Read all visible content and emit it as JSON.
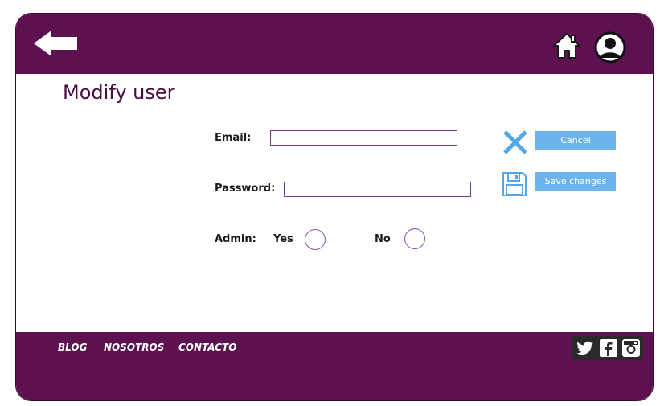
{
  "header": {
    "back": "back-arrow-icon",
    "home": "home-icon",
    "user": "user-icon"
  },
  "page": {
    "title": "Modify user"
  },
  "form": {
    "email_label": "Email:",
    "email_value": "",
    "password_label": "Password:",
    "password_value": "",
    "admin_label": "Admin:",
    "yes_label": "Yes",
    "no_label": "No"
  },
  "actions": {
    "cancel_label": "Cancel",
    "save_label": "Save changes",
    "cancel_icon": "close-x-icon",
    "save_icon": "floppy-disk-icon"
  },
  "footer": {
    "links": [
      "BLOG",
      "NOSOTROS",
      "CONTACTO"
    ],
    "social": [
      "twitter-icon",
      "facebook-icon",
      "instagram-icon"
    ]
  },
  "colors": {
    "brand": "#5e1150",
    "accent": "#6cb4ec",
    "field_border": "#7a3a8c"
  }
}
